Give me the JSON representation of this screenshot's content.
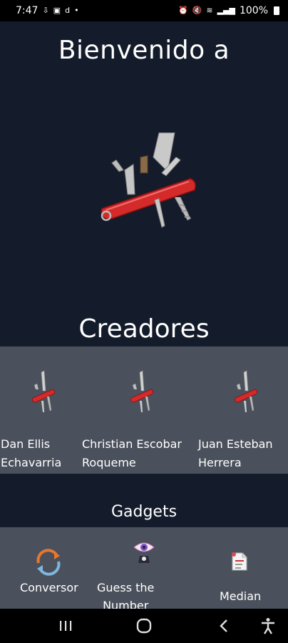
{
  "status_bar": {
    "time": "7:47",
    "battery": "100%",
    "icons": [
      "upload-icon",
      "notification-icon",
      "app-icon",
      "dot-icon",
      "alarm-icon",
      "mute-icon",
      "wifi-icon",
      "signal-icon",
      "battery-icon"
    ]
  },
  "header": {
    "title": "Bienvenido a"
  },
  "creators": {
    "title": "Creadores",
    "items": [
      {
        "line1": "Dan Ellis",
        "line2": "Echavarria"
      },
      {
        "line1": "Christian Escobar",
        "line2": "Roqueme"
      },
      {
        "line1": "Juan Esteban",
        "line2": "Herrera"
      }
    ]
  },
  "gadgets": {
    "title": "Gadgets",
    "items": [
      {
        "label": "Conversor",
        "icon": "convert-icon"
      },
      {
        "label1": "Guess the",
        "label2": "Number",
        "icon": "eye-icon"
      },
      {
        "label": "Median",
        "icon": "document-icon"
      }
    ]
  },
  "nav": {
    "icons": [
      "recents-icon",
      "home-icon",
      "back-icon",
      "accessibility-icon"
    ]
  },
  "colors": {
    "background": "#141b2a",
    "band": "#4b515c",
    "knife_red": "#d42a2a"
  }
}
